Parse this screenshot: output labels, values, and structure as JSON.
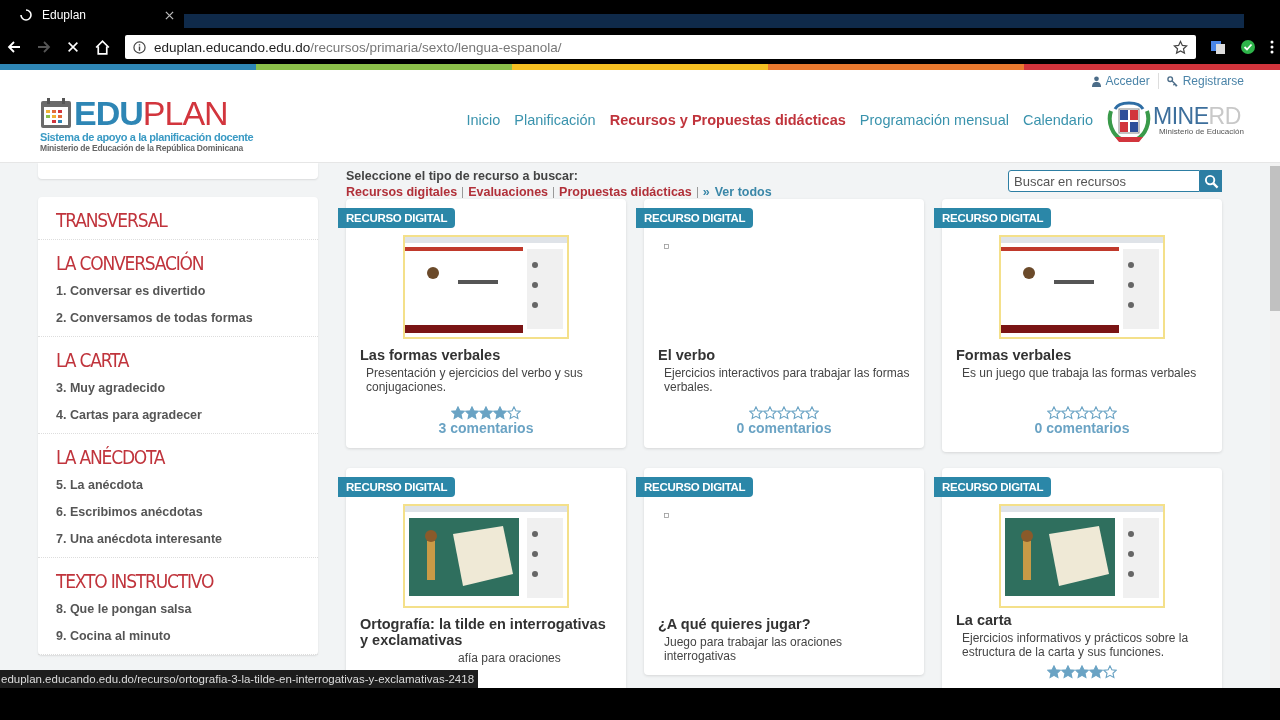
{
  "browser": {
    "tab_title": "Eduplan",
    "url_host": "eduplan.educando.edu.do",
    "url_path": "/recursos/primaria/sexto/lengua-espanola/"
  },
  "header": {
    "logo_main": "EDU",
    "logo_accent": "PLAN",
    "logo_tagline": "Sistema de apoyo a la planificación docente",
    "logo_ministry": "Ministerio de Educación de la República Dominicana",
    "account_links": [
      {
        "kind": "user",
        "label": "Acceder"
      },
      {
        "kind": "key",
        "label": "Registrarse"
      }
    ],
    "nav": [
      {
        "label": "Inicio",
        "selected": false
      },
      {
        "label": "Planificación",
        "selected": false
      },
      {
        "label": "Recursos y Propuestas didácticas",
        "selected": true
      },
      {
        "label": "Programación mensual",
        "selected": false
      },
      {
        "label": "Calendario",
        "selected": false
      }
    ],
    "minerd_main": "MINE",
    "minerd_accent": "RD",
    "minerd_sub": "Ministerio de Educación"
  },
  "sidebar": [
    {
      "title": "TRANSVERSAL"
    },
    {
      "title": "LA CONVERSACIÓN",
      "items": [
        "1. Conversar es divertido",
        "2. Conversamos de todas formas"
      ]
    },
    {
      "title": "LA CARTA",
      "items": [
        "3. Muy agradecido",
        "4. Cartas para agradecer"
      ]
    },
    {
      "title": "LA ANÉCDOTA",
      "items": [
        "5. La anécdota",
        "6. Escribimos anécdotas",
        "7. Una anécdota interesante"
      ]
    },
    {
      "title": "TEXTO INSTRUCTIVO",
      "items": [
        "8. Que le pongan salsa",
        "9. Cocina al minuto"
      ]
    }
  ],
  "filter": {
    "prompt": "Seleccione el tipo de recurso a buscar:",
    "links": [
      "Recursos digitales",
      "Evaluaciones",
      "Propuestas didácticas"
    ],
    "all_marker": "»",
    "all_link": "Ver todos"
  },
  "search": {
    "placeholder": "Buscar en recursos"
  },
  "columns": [
    [
      {
        "badge": "RECURSO DIGITAL",
        "kind": "picture",
        "title": "Las formas verbales",
        "description": "Presentación y ejercicios del verbo y sus conjugaciones.",
        "stars": 4,
        "comments": "3 comentarios"
      },
      {
        "badge": "RECURSO DIGITAL",
        "kind": "picture",
        "title": "Ortografía: la tilde en interrogativas y exclamativas",
        "description": "afía para oraciones"
      }
    ],
    [
      {
        "badge": "RECURSO DIGITAL",
        "title": "El verbo",
        "description": "Ejercicios interactivos para trabajar las formas verbales.",
        "stars": 0,
        "comments": "0 comentarios"
      },
      {
        "badge": "RECURSO DIGITAL",
        "title": "¿A qué quieres jugar?",
        "description": "Juego para trabajar las oraciones interrogativas"
      }
    ],
    [
      {
        "badge": "RECURSO DIGITAL",
        "kind": "picture",
        "title": "Formas verbales",
        "description": "Es un juego que trabaja las formas verbales",
        "stars": 0,
        "comments": "0 comentarios"
      },
      {
        "badge": "RECURSO DIGITAL",
        "kind": "picture",
        "title": "La carta",
        "description": "Ejercicios informativos y prácticos sobre la estructura de la carta y sus funciones.",
        "stars": 4
      }
    ]
  ],
  "status_url": "eduplan.educando.edu.do/recurso/ortografia-3-la-tilde-en-interrogativas-y-exclamativas-2418"
}
